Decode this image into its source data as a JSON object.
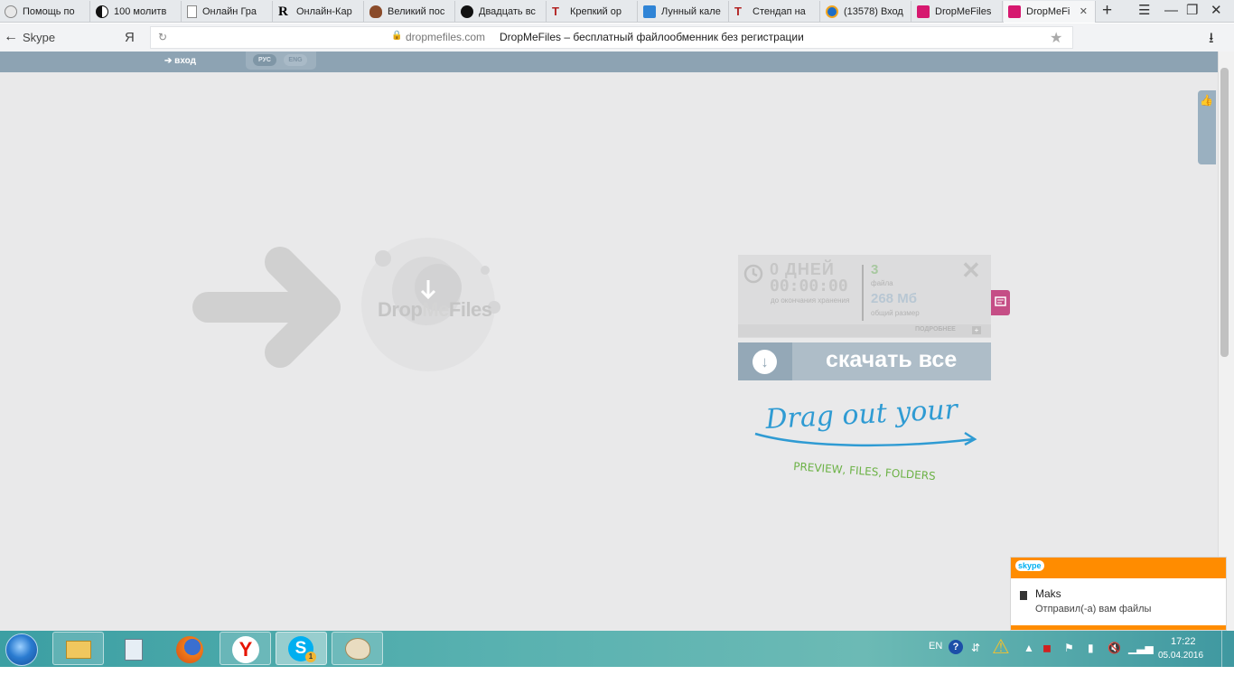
{
  "browser": {
    "tabs": [
      {
        "title": "Помощь по",
        "favicon": "wikipedia-icon",
        "color": "#555b6e"
      },
      {
        "title": "100 молитв",
        "favicon": "yin-yang-icon",
        "color": "#111111"
      },
      {
        "title": "Онлайн Гра",
        "favicon": "page-icon",
        "color": "#ffffff"
      },
      {
        "title": "Онлайн-Кар",
        "favicon": "r-letter-icon",
        "color": "#ffffff"
      },
      {
        "title": "Великий пос",
        "favicon": "bowl-icon",
        "color": "#8a4b2a"
      },
      {
        "title": "Двадцать вс",
        "favicon": "moon-icon",
        "color": "#111111"
      },
      {
        "title": "Крепкий ор",
        "favicon": "t-red-icon",
        "color": "#b22222"
      },
      {
        "title": "Лунный кале",
        "favicon": "person-icon",
        "color": "#2f84d6"
      },
      {
        "title": "Стендап на",
        "favicon": "t-red-icon",
        "color": "#b22222"
      },
      {
        "title": "(13578) Вход",
        "favicon": "odnoklassniki-icon",
        "color": "#1e6ec7"
      },
      {
        "title": "DropMeFiles",
        "favicon": "dropmefiles-icon",
        "color": "#d6186f"
      },
      {
        "title": "DropMeFi",
        "favicon": "dropmefiles-icon",
        "color": "#d6186f",
        "active": true
      }
    ],
    "back_label": "Skype",
    "yandex_letter": "Я",
    "url_domain": "dropmefiles.com",
    "url_title": "DropMeFiles – бесплатный файлообменник без регистрации"
  },
  "site": {
    "login_label": "вход",
    "lang_ru": "РУС",
    "lang_en": "ENG",
    "dropzone_word_a": "Drop",
    "dropzone_word_b": "Me",
    "dropzone_word_c": "Files",
    "widget": {
      "days": "0 ДНЕЙ",
      "timer": "00:00:00",
      "until_deletion": "до окончания хранения",
      "file_count": "3",
      "file_label": "файла",
      "size_value": "268 Мб",
      "size_label": "общий размер",
      "more_label": "ПОДРОБНЕЕ",
      "download_all": "скачать все"
    },
    "drag_hint_line1": "Drag out your",
    "drag_hint_line2": "PREVIEW, FILES, FOLDERS"
  },
  "taskbar": {
    "apps": [
      "explorer-icon",
      "calculator-icon",
      "firefox-icon",
      "yandex-browser-icon",
      "skype-icon",
      "paint-icon"
    ],
    "skype_badge": "1",
    "tray_lang": "EN",
    "time": "17:22",
    "date": "05.04.2016"
  },
  "skype_toast": {
    "brand": "skype",
    "sender": "Maks",
    "message": "Отправил(-а) вам файлы"
  },
  "colors": {
    "site_strip": "#8da3b3",
    "page_bg": "#e9e9ea",
    "download_button": "#aebdc8",
    "drag_hint_blue": "#2f9bd3",
    "drag_hint_green": "#6cb246",
    "skype_orange": "#ff8c00"
  }
}
